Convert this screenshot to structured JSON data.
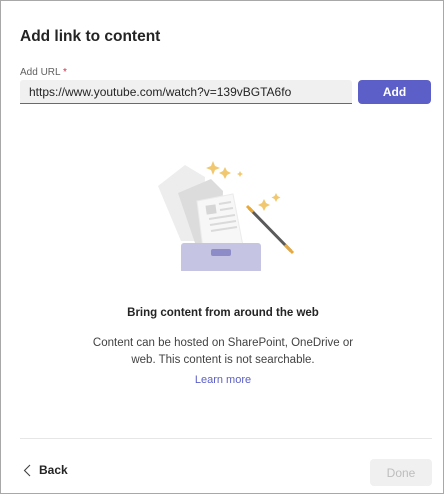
{
  "dialog": {
    "title": "Add link to content",
    "url_label": "Add URL",
    "required_mark": "*",
    "url_value": "https://www.youtube.com/watch?v=139vBGTA6fo",
    "add_label": "Add",
    "empty_state": {
      "illustration_icon": "content-box-magic-wand-illustration",
      "heading": "Bring content from around the web",
      "description": "Content can be hosted on SharePoint, OneDrive or web. This content is not searchable.",
      "learn_more": "Learn more"
    },
    "back_label": "Back",
    "done_label": "Done"
  },
  "colors": {
    "accent": "#5b5fc7",
    "box": "#c5c4e3",
    "wand_tip": "#e9a83a"
  }
}
